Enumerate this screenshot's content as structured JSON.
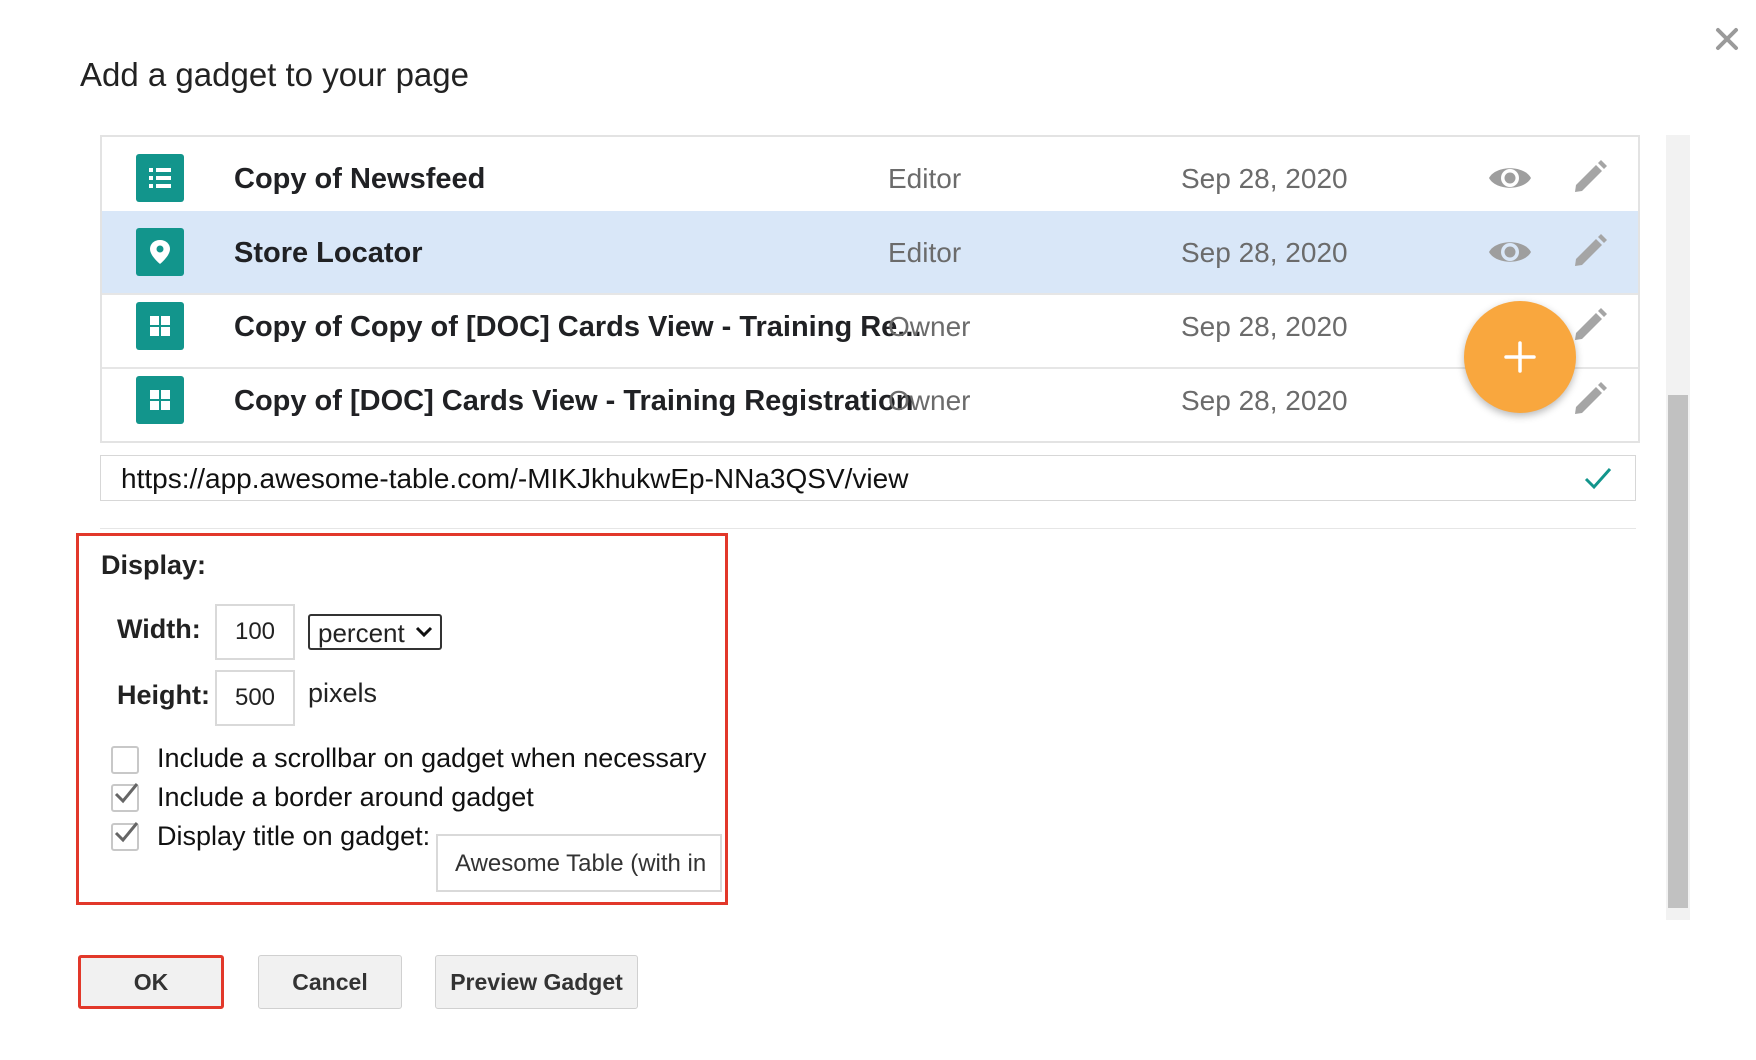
{
  "dialog": {
    "title": "Add a gadget to your page",
    "close_icon": "close-icon"
  },
  "gadget_list": {
    "rows": [
      {
        "icon": "list-icon",
        "name": "Copy of Newsfeed",
        "role": "Editor",
        "date": "Sep 28, 2020",
        "selected": false
      },
      {
        "icon": "map-pin-icon",
        "name": "Store Locator",
        "role": "Editor",
        "date": "Sep 28, 2020",
        "selected": true
      },
      {
        "icon": "grid-icon",
        "name": "Copy of Copy of [DOC] Cards View - Training Re...",
        "role": "Owner",
        "date": "Sep 28, 2020",
        "selected": false
      },
      {
        "icon": "grid-icon",
        "name": "Copy of [DOC] Cards View - Training Registration",
        "role": "Owner",
        "date": "Sep 28, 2020",
        "selected": false
      }
    ],
    "row_actions": [
      "eye-icon",
      "pencil-icon"
    ],
    "fab_icon": "plus-icon"
  },
  "url_field": {
    "value": "https://app.awesome-table.com/-MIKJkhukwEp-NNa3QSV/view",
    "status_icon": "check-icon"
  },
  "display": {
    "heading": "Display:",
    "width_label": "Width:",
    "width_value": "100",
    "width_unit": "percent",
    "height_label": "Height:",
    "height_value": "500",
    "height_unit": "pixels",
    "options": [
      {
        "label": "Include a scrollbar on gadget when necessary",
        "checked": false
      },
      {
        "label": "Include a border around gadget",
        "checked": true
      },
      {
        "label": "Display title on gadget:",
        "checked": true
      }
    ],
    "title_value": "Awesome Table (with in"
  },
  "buttons": {
    "ok": "OK",
    "cancel": "Cancel",
    "preview": "Preview Gadget"
  },
  "colors": {
    "accent_teal": "#12958c",
    "selected_row": "#d9e7f8",
    "fab_orange": "#f9a73e",
    "highlight_red": "#e2382a",
    "valid_check": "#12958c"
  }
}
